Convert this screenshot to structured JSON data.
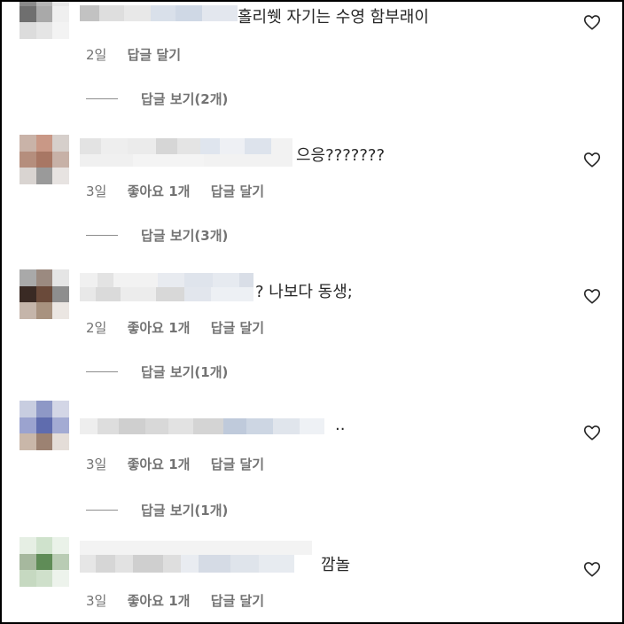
{
  "comments": [
    {
      "text": "홀리쒯 자기는 수영 함부래이",
      "age": "2일",
      "likes": "",
      "reply_label": "답글 달기",
      "view_replies": "답글 보기(2개)",
      "avatar_colors": [
        "#8a8a8a",
        "#b5b5b5",
        "#e8e8e8",
        "#6f6f6f",
        "#a9a9a9",
        "#efefef",
        "#dcdcdc",
        "#e5e5e5",
        "#f3f3f3"
      ]
    },
    {
      "text": "으응???????",
      "age": "3일",
      "likes": "좋아요 1개",
      "reply_label": "답글 달기",
      "view_replies": "답글 보기(3개)",
      "avatar_colors": [
        "#c9b3a8",
        "#c99886",
        "#d6cfcb",
        "#b58e7d",
        "#a87764",
        "#c7b1a7",
        "#d9d4d1",
        "#9a9a9a",
        "#e7e3e1"
      ]
    },
    {
      "text": "? 나보다 동생;",
      "age": "2일",
      "likes": "좋아요 1개",
      "reply_label": "답글 달기",
      "view_replies": "답글 보기(1개)",
      "avatar_colors": [
        "#a9a9a9",
        "#9b8a80",
        "#e5e5e5",
        "#3a2a24",
        "#6a4a3a",
        "#8e8e8e",
        "#c5b5aa",
        "#a8927f",
        "#ebe6e2"
      ]
    },
    {
      "text": "..",
      "age": "3일",
      "likes": "좋아요 1개",
      "reply_label": "답글 달기",
      "view_replies": "답글 보기(1개)",
      "avatar_colors": [
        "#c8cde0",
        "#8e98c6",
        "#d3d6e6",
        "#9ba3cf",
        "#5f6cae",
        "#a3abd3",
        "#c9b7a9",
        "#9c8272",
        "#e4ddd8"
      ]
    },
    {
      "text": "깜놀",
      "age": "3일",
      "likes": "좋아요 1개",
      "reply_label": "답글 달기",
      "view_replies": "",
      "avatar_colors": [
        "#e6efe4",
        "#cfe2cc",
        "#eaf2e9",
        "#a6b89e",
        "#5f8c57",
        "#b9ccb4",
        "#c6d9c1",
        "#cfe0cb",
        "#edf3ec"
      ]
    }
  ]
}
